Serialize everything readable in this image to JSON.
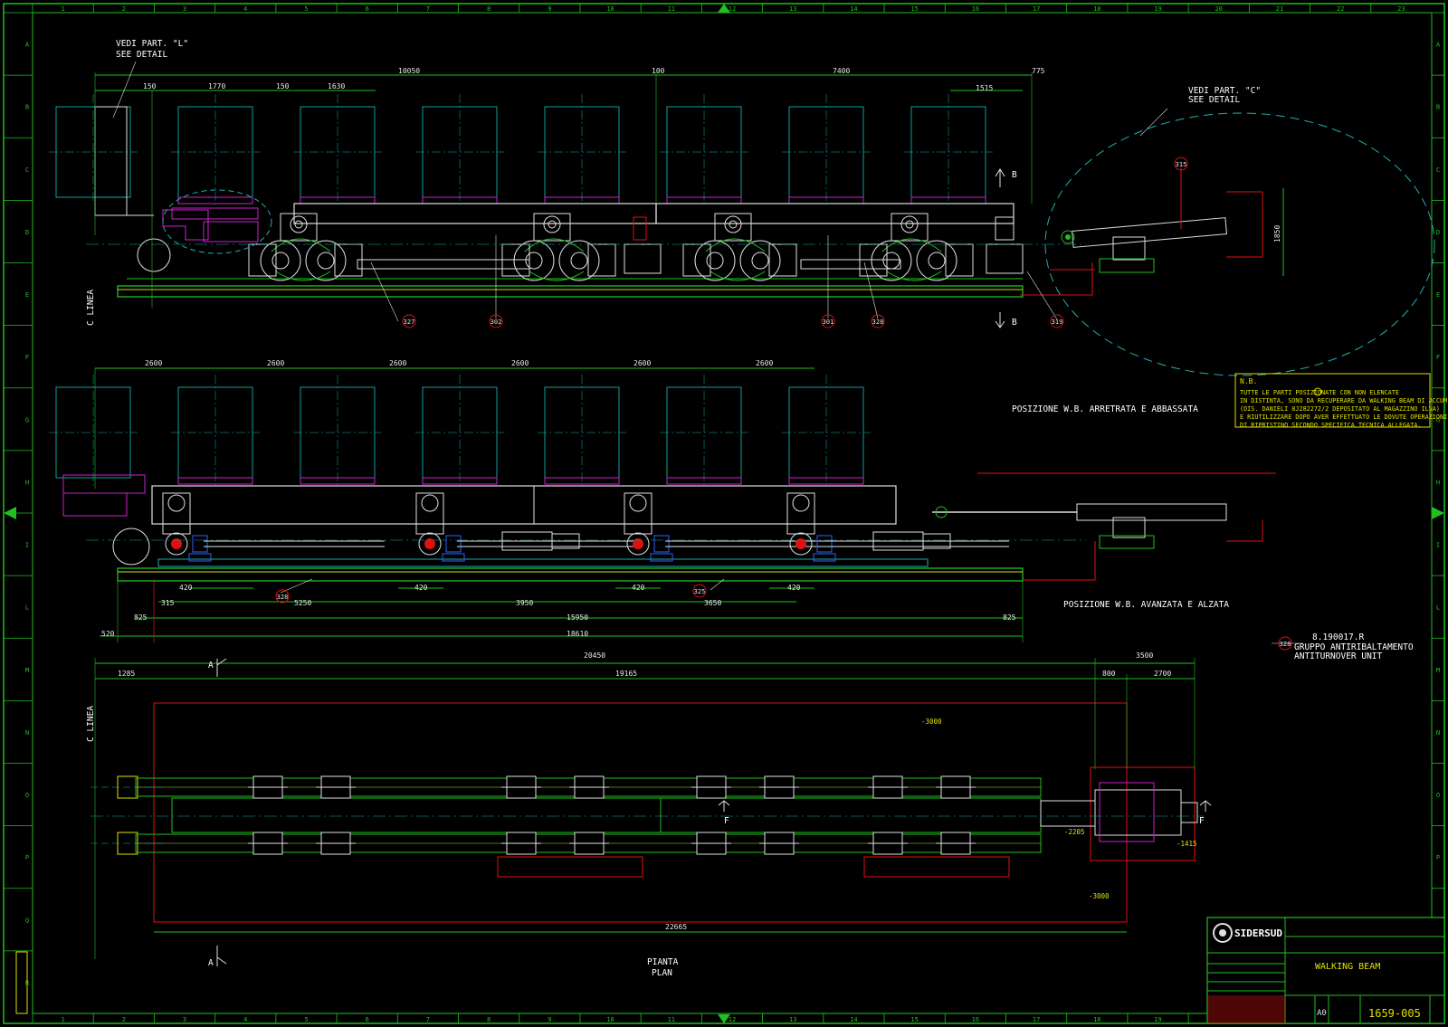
{
  "drawing": {
    "grid_cols": [
      "1",
      "2",
      "3",
      "4",
      "5",
      "6",
      "7",
      "8",
      "9",
      "10",
      "11",
      "12",
      "13",
      "14",
      "15",
      "16",
      "17",
      "18",
      "19",
      "20",
      "21",
      "22",
      "23"
    ],
    "grid_rows": [
      "A",
      "B",
      "C",
      "D",
      "E",
      "F",
      "G",
      "H",
      "I",
      "L",
      "M",
      "N",
      "O",
      "P",
      "Q",
      "R"
    ],
    "notes": {
      "detail_l_1": "VEDI PART. \"L\"",
      "detail_l_2": "SEE DETAIL",
      "detail_c_1": "VEDI PART. \"C\"",
      "detail_c_2": "SEE DETAIL",
      "linea_1": "C LINEA",
      "linea_2": "C LINEA",
      "pos_retracted": "POSIZIONE W.B. ARRETRATA E ABBASSATA",
      "pos_advanced": "POSIZIONE W.B. AVANZATA E ALZATA",
      "plan_1": "PIANTA",
      "plan_2": "PLAN",
      "section_a_top": "A",
      "section_a_bottom": "A",
      "section_b_top": "B",
      "section_b_bottom": "B",
      "section_f_left": "F",
      "section_f_right": "F",
      "nb_title": "N.B.",
      "nb_lines": [
        "TUTTE LE PARTI POSIZIONATE CON    NON ELENCATE",
        "IN DISTINTA, SONO DA RECUPERARE DA WALKING BEAM DI ACCUM.",
        "(DIS. DANIELI 8J282272/2 DEPOSITATO AL MAGAZZINO ILVA)",
        "E RIUTILIZZARE DOPO AVER EFFETTUATO LE DOVUTE OPERAZIONI",
        "DI RIPRISTINO SECONDO SPECIFICA TECNICA ALLEGATA."
      ],
      "unit_code": "8.190017.R",
      "unit_it": "GRUPPO ANTIRIBALTAMENTO",
      "unit_en": "ANTITURNOVER UNIT"
    },
    "balloons": {
      "b315": "315",
      "b327": "327",
      "b302": "302",
      "b301": "301",
      "b328a": "328",
      "b319": "319",
      "b328b": "328",
      "b325": "325",
      "b328c": "328"
    },
    "dims_top": {
      "d10050": "10050",
      "d100": "100",
      "d7400": "7400",
      "d775": "775",
      "d150a": "150",
      "d1770": "1770",
      "d150b": "150",
      "d1630": "1630",
      "d1515": "1515",
      "d1850": "1850"
    },
    "dims_mid": {
      "p1": "2600",
      "p2": "2600",
      "p3": "2600",
      "p4": "2600",
      "p5": "2600",
      "p6": "2600",
      "d420a": "420",
      "d420b": "420",
      "d420c": "420",
      "d420d": "420",
      "d315": "315",
      "d5250": "5250",
      "d3950": "3950",
      "d3650": "3650",
      "d825a": "825",
      "d825b": "825",
      "d15950": "15950",
      "d520": "520",
      "d18610": "18610"
    },
    "dims_plan": {
      "d20450": "20450",
      "d3500": "3500",
      "d1285": "1285",
      "d19165": "19165",
      "d800": "800",
      "d2700": "2700",
      "d22665": "22665",
      "lv3000a": "-3000",
      "lv2205": "-2205",
      "lv1415": "-1415",
      "lv3000b": "-3000"
    },
    "title_block": {
      "company": "SIDERSUD",
      "title": "WALKING BEAM",
      "size": "A0",
      "number": "1659-005"
    },
    "colors": {
      "frame": "#20c020",
      "structure": "#e0e0e0",
      "dimensions": "#20c020",
      "envelope": "#e01010",
      "pallet": "#10b0b0",
      "support": "#d020d0",
      "note": "#e0e000"
    }
  }
}
